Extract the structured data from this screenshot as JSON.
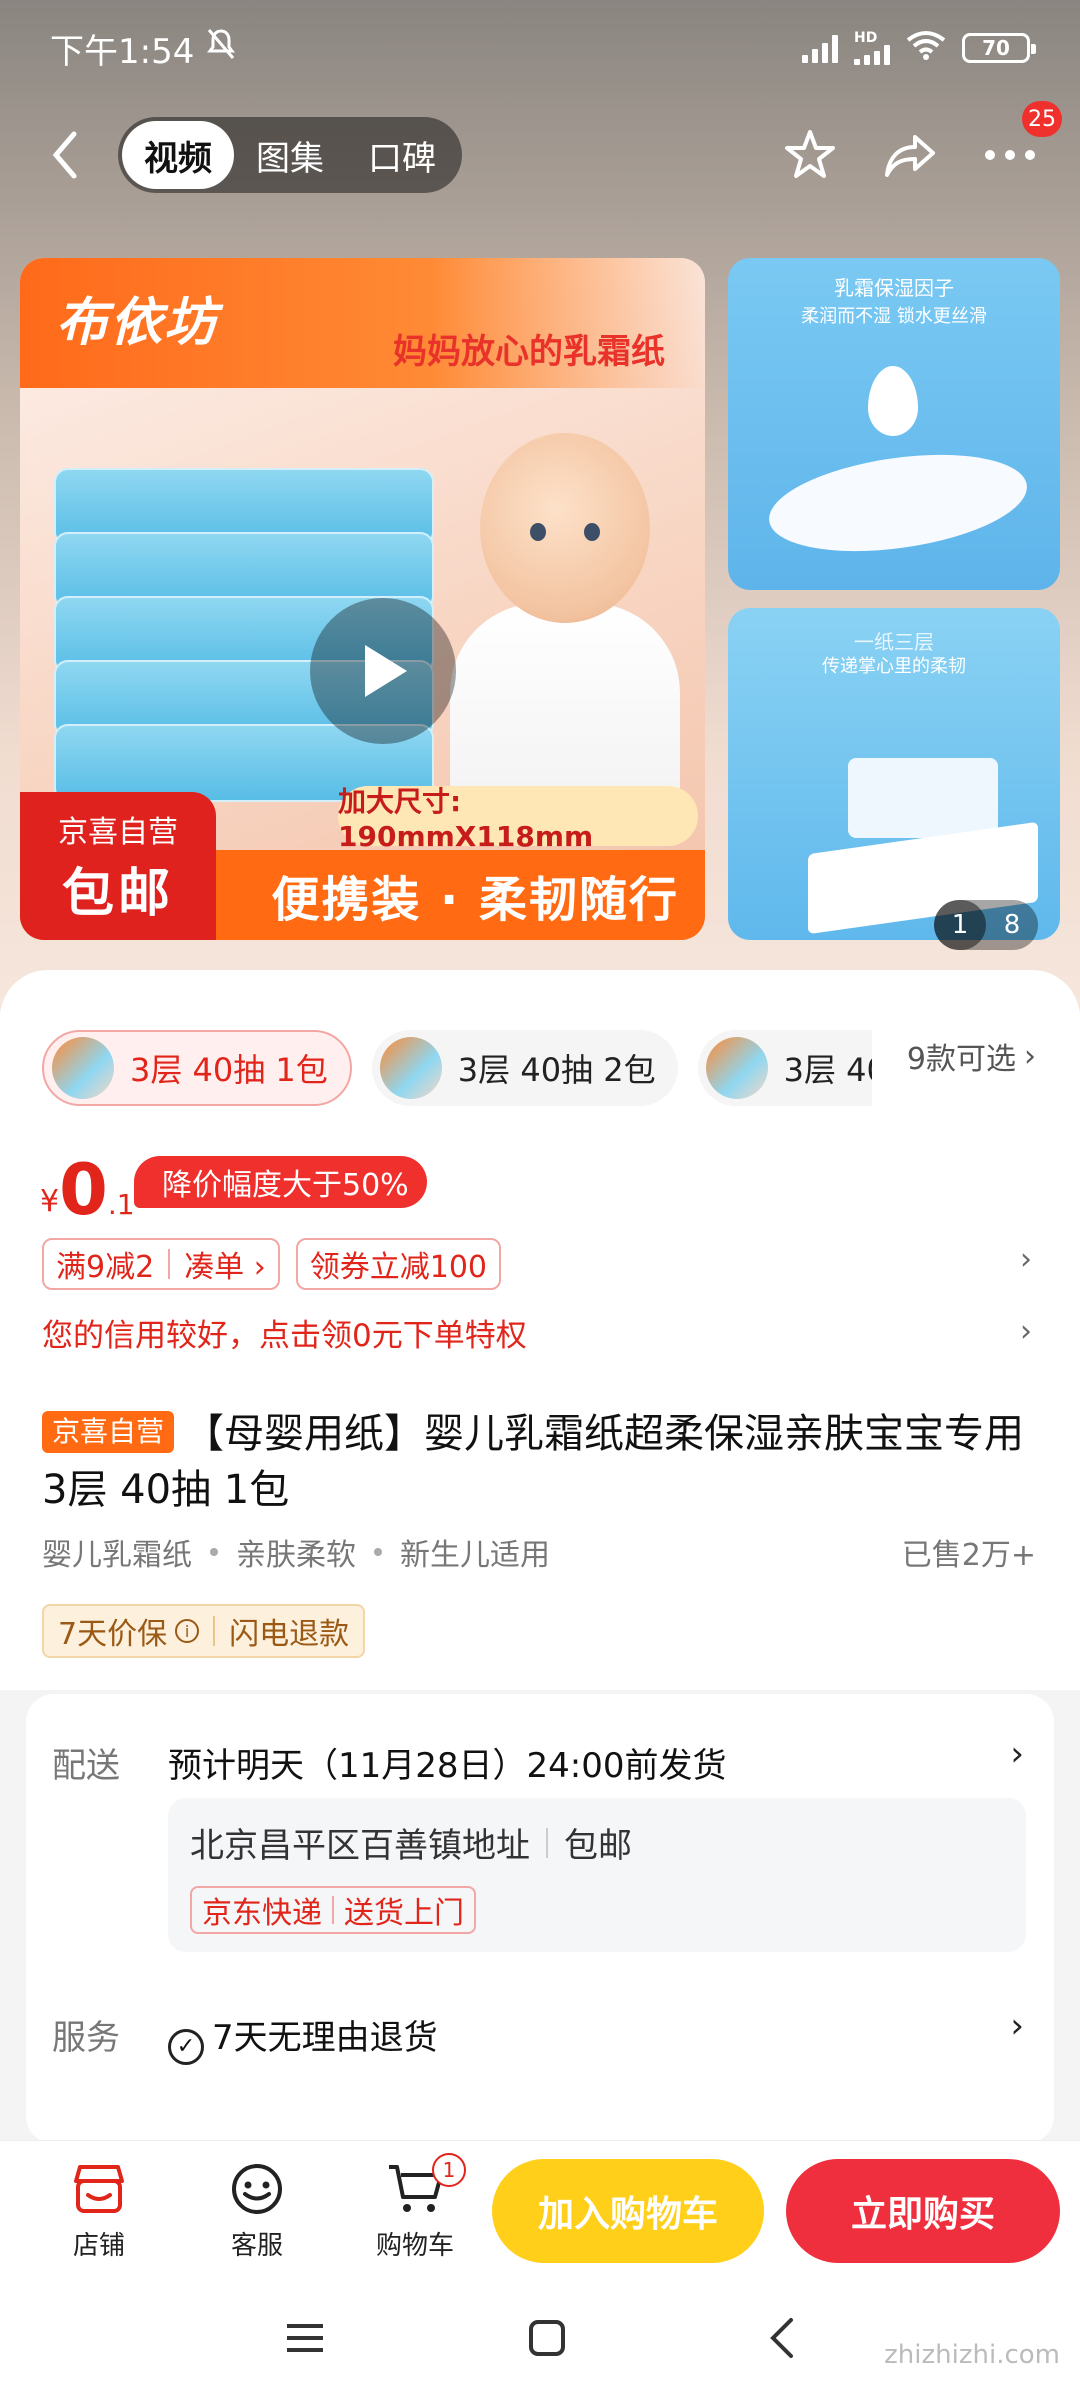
{
  "status_bar": {
    "time": "下午1:54",
    "battery": "70",
    "hd": "HD"
  },
  "nav": {
    "tabs": [
      "视频",
      "图集",
      "口碑"
    ],
    "active_tab": 0,
    "more_badge": "25"
  },
  "gallery": {
    "brand": "布依坊",
    "slogan": "妈妈放心的乳霜纸",
    "size_tag": "加大尺寸: 190mmX118mm",
    "bottom_text": "便携装 · 柔韧随行",
    "self_op_line1": "京喜自营",
    "self_op_line2": "包邮",
    "side1_title": "乳霜保湿因子",
    "side1_sub": "柔润而不湿 锁水更丝滑",
    "side2_title": "一纸三层",
    "side2_sub": "传递掌心里的柔韧",
    "current_index": "1",
    "total": "8"
  },
  "variants": {
    "items": [
      {
        "label": "3层 40抽 1包",
        "selected": true
      },
      {
        "label": "3层 40抽 2包",
        "selected": false
      },
      {
        "label": "3层 40",
        "selected": false
      }
    ],
    "more": "9款可选"
  },
  "price": {
    "currency": "¥",
    "integer": "0",
    "decimal": ".1",
    "drop_tag": "降价幅度大于50%"
  },
  "promos": {
    "discount": "满9减2",
    "combine": "凑单 ›",
    "coupon": "领券立减100",
    "credit": "您的信用较好，点击领0元下单特权"
  },
  "product": {
    "self_op_tag": "京喜自营",
    "title": "【母婴用纸】婴儿乳霜纸超柔保湿亲肤宝宝专用 3层 40抽 1包",
    "attrs": [
      "婴儿乳霜纸",
      "亲肤柔软",
      "新生儿适用"
    ],
    "sold": "已售2万+",
    "guarantee_1": "7天价保",
    "guarantee_2": "闪电退款"
  },
  "delivery": {
    "label": "配送",
    "eta": "预计明天（11月28日）24:00前发货",
    "address": "北京昌平区百善镇地址",
    "shipping": "包邮",
    "carrier": "京东快递",
    "carrier_service": "送货上门",
    "service_label": "服务",
    "service_value": "7天无理由退货"
  },
  "bottom_bar": {
    "store": "店铺",
    "service": "客服",
    "cart": "购物车",
    "cart_count": "1",
    "add_to_cart": "加入购物车",
    "buy_now": "立即购买"
  },
  "watermark": "zhizhizhi.com",
  "colors": {
    "accent_red": "#e1251b",
    "cart_yellow": "#ffcf1a",
    "buy_red": "#ef2f3d",
    "self_op_orange": "#ff6a12"
  }
}
